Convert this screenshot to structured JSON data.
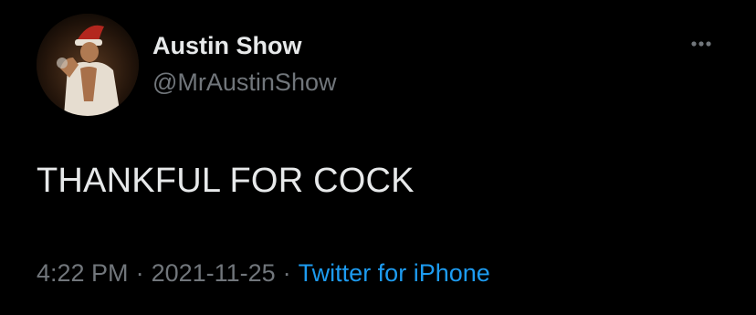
{
  "tweet": {
    "author": {
      "display_name": "Austin Show",
      "handle": "@MrAustinShow",
      "avatar_icon": "profile-photo"
    },
    "text": "THANKFUL FOR COCK",
    "meta": {
      "time": "4:22 PM",
      "separator": "·",
      "date": "2021-11-25",
      "source": "Twitter for iPhone"
    },
    "more_icon": "ellipsis-icon"
  },
  "colors": {
    "background": "#000000",
    "primary_text": "#e7e9ea",
    "secondary_text": "#71767b",
    "link": "#1d9bf0"
  }
}
